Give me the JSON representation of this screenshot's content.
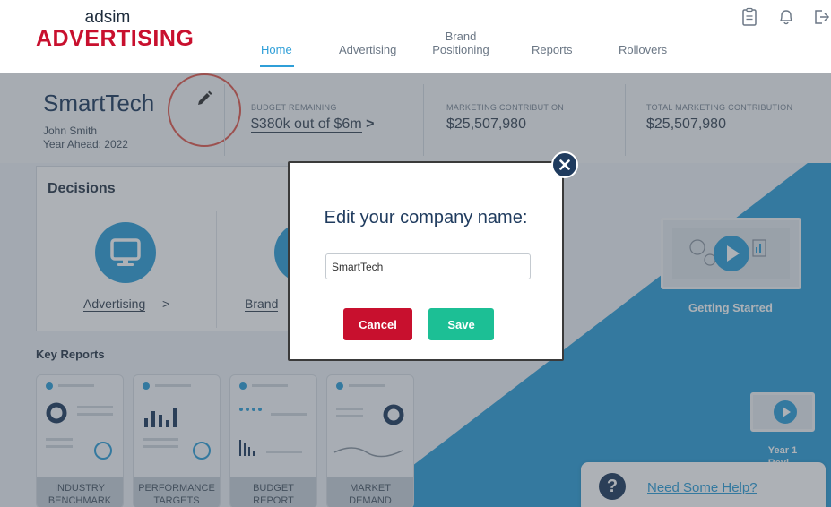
{
  "logo": {
    "top": "adsim",
    "bottom": "ADVERTISING"
  },
  "nav": {
    "home": "Home",
    "advertising": "Advertising",
    "brand_line1": "Brand",
    "brand_line2": "Positioning",
    "reports": "Reports",
    "rollovers": "Rollovers"
  },
  "header_icons": [
    "clipboard-icon",
    "bell-icon",
    "exit-icon"
  ],
  "company": {
    "name": "SmartTech",
    "user": "John Smith",
    "year": "Year Ahead: 2022"
  },
  "stats": {
    "budget_label": "BUDGET REMAINING",
    "budget_value": "$380k out of $6m",
    "budget_arrow": ">",
    "marketing_label": "MARKETING CONTRIBUTION",
    "marketing_value": "$25,507,980",
    "total_label": "TOTAL MARKETING CONTRIBUTION",
    "total_value": "$25,507,980"
  },
  "decisions": {
    "title": "Decisions",
    "advertising_label": "Advertising",
    "advertising_arrow": ">",
    "brand_label": "Brand"
  },
  "videos": {
    "getting_started": "Getting Started",
    "year1_line1": "Year 1",
    "year1_line2": "Revi..."
  },
  "key_reports": {
    "title": "Key Reports",
    "cards": [
      {
        "line1": "INDUSTRY",
        "line2": "BENCHMARK"
      },
      {
        "line1": "PERFORMANCE",
        "line2": "TARGETS"
      },
      {
        "line1": "BUDGET",
        "line2": "REPORT"
      },
      {
        "line1": "MARKET",
        "line2": "DEMAND"
      }
    ]
  },
  "help": {
    "q": "?",
    "link": "Need Some Help?"
  },
  "modal": {
    "title": "Edit your company name:",
    "input_value": "SmartTech",
    "cancel": "Cancel",
    "save": "Save"
  },
  "colors": {
    "brand_red": "#c8102e",
    "accent_blue": "#2f9fd8",
    "navy": "#1f3b5e",
    "save_green": "#1cbf95"
  }
}
